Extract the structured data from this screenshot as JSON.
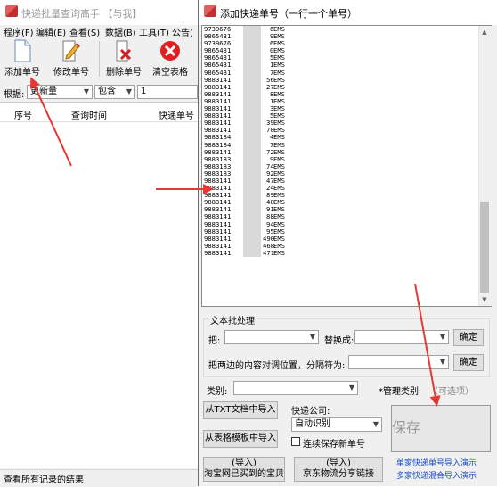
{
  "bg_window": {
    "title": "快递批量查询高手 【与我】",
    "menu": [
      "程序(F)",
      "编辑(E)",
      "查看(S)",
      "数据(B)",
      "工具(T)",
      "公告("
    ],
    "toolbar": {
      "add": "添加单号",
      "edit": "修改单号",
      "delete": "删除单号",
      "clear": "清空表格"
    },
    "filter": {
      "label": "根据:",
      "field_value": "更新量",
      "mode_value": "包含",
      "search_value": "1"
    },
    "table_headers": [
      "序号",
      "查询时间",
      "快递单号"
    ],
    "status": "查看所有记录的结果"
  },
  "dialog": {
    "title": "添加快递单号（一行一个单号）",
    "tracking_lines": [
      {
        "num": "9739676",
        "tail": "6",
        "carrier": "EMS"
      },
      {
        "num": "9865431",
        "tail": "9",
        "carrier": "EMS"
      },
      {
        "num": "9739676",
        "tail": "6",
        "carrier": "EMS"
      },
      {
        "num": "9865431",
        "tail": "0",
        "carrier": "EMS"
      },
      {
        "num": "9865431",
        "tail": "5",
        "carrier": "EMS"
      },
      {
        "num": "9865431",
        "tail": "1",
        "carrier": "EMS"
      },
      {
        "num": "9865431",
        "tail": "7",
        "carrier": "EMS"
      },
      {
        "num": "9883141",
        "tail": "56",
        "carrier": "EMS"
      },
      {
        "num": "9883141",
        "tail": "27",
        "carrier": "EMS"
      },
      {
        "num": "9883141",
        "tail": "8",
        "carrier": "EMS"
      },
      {
        "num": "9883141",
        "tail": "1",
        "carrier": "EMS"
      },
      {
        "num": "9883141",
        "tail": "3",
        "carrier": "EMS"
      },
      {
        "num": "9883141",
        "tail": "5",
        "carrier": "EMS"
      },
      {
        "num": "9883141",
        "tail": "39",
        "carrier": "EMS"
      },
      {
        "num": "9883141",
        "tail": "70",
        "carrier": "EMS"
      },
      {
        "num": "9883184",
        "tail": "4",
        "carrier": "EMS"
      },
      {
        "num": "9883184",
        "tail": "7",
        "carrier": "EMS"
      },
      {
        "num": "9883141",
        "tail": "72",
        "carrier": "EMS"
      },
      {
        "num": "9883183",
        "tail": "9",
        "carrier": "EMS"
      },
      {
        "num": "9883183",
        "tail": "74",
        "carrier": "EMS"
      },
      {
        "num": "9883183",
        "tail": "92",
        "carrier": "EMS"
      },
      {
        "num": "9883141",
        "tail": "47",
        "carrier": "EMS"
      },
      {
        "num": "9883141",
        "tail": "24",
        "carrier": "EMS"
      },
      {
        "num": "9883141",
        "tail": "89",
        "carrier": "EMS"
      },
      {
        "num": "9883141",
        "tail": "40",
        "carrier": "EMS"
      },
      {
        "num": "9883141",
        "tail": "91",
        "carrier": "EMS"
      },
      {
        "num": "9883141",
        "tail": "88",
        "carrier": "EMS"
      },
      {
        "num": "9883141",
        "tail": "94",
        "carrier": "EMS"
      },
      {
        "num": "9883141",
        "tail": "95",
        "carrier": "EMS"
      },
      {
        "num": "9883141",
        "tail": "490",
        "carrier": "EMS"
      },
      {
        "num": "9883141",
        "tail": "468",
        "carrier": "EMS"
      },
      {
        "num": "9883141",
        "tail": "471",
        "carrier": "EMS"
      }
    ],
    "batch": {
      "group_label": "文本批处理",
      "replace_label": "把:",
      "replace_with_label": "替换成:",
      "confirm_1": "确定",
      "swap_label": "把两边的内容对调位置，分隔符为:",
      "confirm_2": "确定"
    },
    "category": {
      "label": "类别:",
      "manage_label": "*管理类别",
      "optional": "（可选项）"
    },
    "import": {
      "from_txt": "从TXT文档中导入",
      "from_excel": "从表格模板中导入",
      "taobao_line1": "(导入)",
      "taobao_line2": "淘宝网已买到的宝贝",
      "jd_line1": "(导入)",
      "jd_line2": "京东物流分享链接"
    },
    "courier": {
      "label": "快递公司:",
      "value": "自动识别",
      "save_new_label": "连续保存新单号"
    },
    "save_label": "保存",
    "demo_link_1": "单家快递单号导入演示",
    "demo_link_2": "多家快递混合导入演示"
  },
  "colors": {
    "arrow": "#e53935",
    "link": "#1a4fd0"
  }
}
